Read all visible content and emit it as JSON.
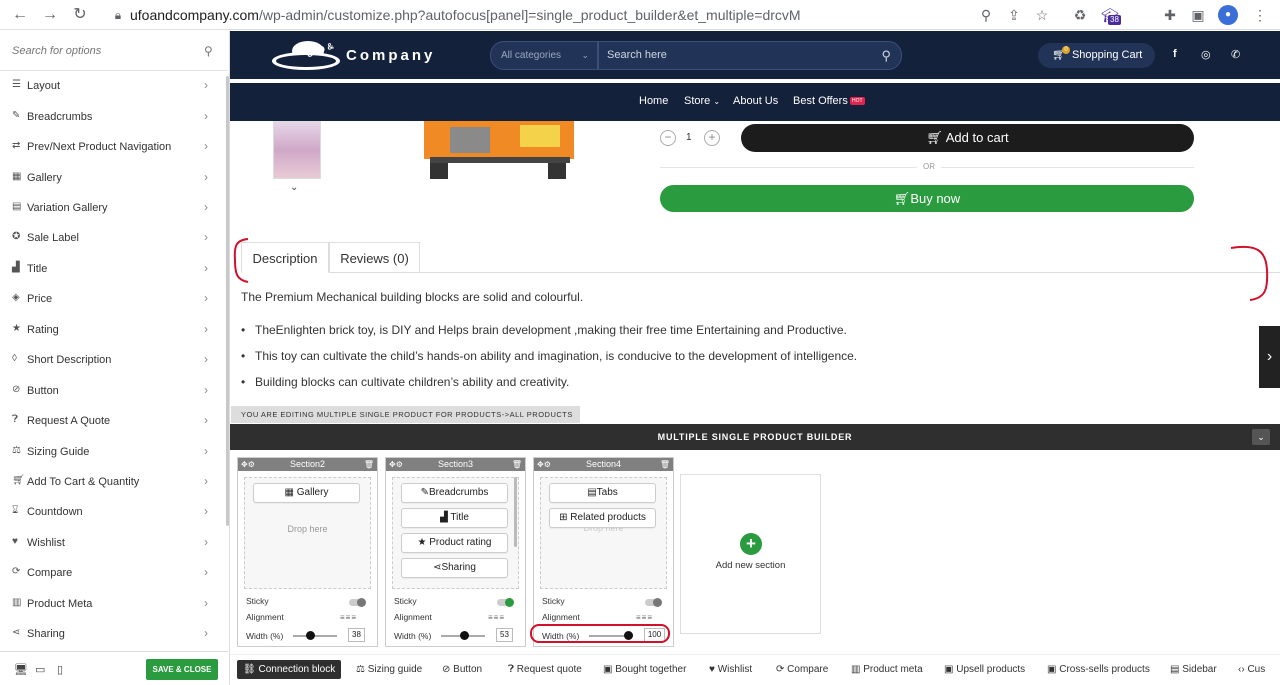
{
  "browser": {
    "url_host": "ufoandcompany.com",
    "url_path": "/wp-admin/customize.php?autofocus[panel]=single_product_builder&et_multiple=drcvM",
    "badge_count": "38"
  },
  "sidebar": {
    "search_placeholder": "Search for options",
    "items": [
      {
        "label": "Layout",
        "icon": "layout-icon"
      },
      {
        "label": "Breadcrumbs",
        "icon": "pen-icon"
      },
      {
        "label": "Prev/Next Product Navigation",
        "icon": "navigation-icon"
      },
      {
        "label": "Gallery",
        "icon": "gallery-icon"
      },
      {
        "label": "Variation Gallery",
        "icon": "variation-gallery-icon"
      },
      {
        "label": "Sale Label",
        "icon": "tag-icon"
      },
      {
        "label": "Title",
        "icon": "title-icon"
      },
      {
        "label": "Price",
        "icon": "price-tag-icon"
      },
      {
        "label": "Rating",
        "icon": "star-icon"
      },
      {
        "label": "Short Description",
        "icon": "description-icon"
      },
      {
        "label": "Button",
        "icon": "button-icon"
      },
      {
        "label": "Request A Quote",
        "icon": "question-icon"
      },
      {
        "label": "Sizing Guide",
        "icon": "ruler-icon"
      },
      {
        "label": "Add To Cart & Quantity",
        "icon": "cart-icon"
      },
      {
        "label": "Countdown",
        "icon": "hourglass-icon"
      },
      {
        "label": "Wishlist",
        "icon": "heart-icon"
      },
      {
        "label": "Compare",
        "icon": "compare-icon"
      },
      {
        "label": "Product Meta",
        "icon": "meta-icon"
      },
      {
        "label": "Sharing",
        "icon": "share-icon"
      }
    ],
    "save_label": "SAVE & CLOSE"
  },
  "site": {
    "logo_badge": "UFO &",
    "logo_text": "Company",
    "category_placeholder": "All categories",
    "search_placeholder": "Search here",
    "cart_label": "Shopping Cart",
    "cart_count": "0",
    "menu": [
      "Home",
      "Store",
      "About Us",
      "Best Offers"
    ],
    "hot_badge": "HOT"
  },
  "product": {
    "qty": "1",
    "add_to_cart": "Add to cart",
    "or": "OR",
    "buy_now": "Buy now",
    "tabs": [
      "Description",
      "Reviews (0)"
    ],
    "description_lead": "The Premium Mechanical building blocks are solid and colourful.",
    "bullets": [
      "TheEnlighten brick toy, is DIY and Helps brain development ,making their free time Entertaining and Productive.",
      "This toy can cultivate the child’s hands-on ability and imagination, is conducive to the development of intelligence.",
      "Building blocks can cultivate children’s ability and creativity."
    ]
  },
  "builder": {
    "editing_label": "YOU ARE EDITING MULTIPLE SINGLE PRODUCT FOR PRODUCTS->ALL PRODUCTS",
    "title": "MULTIPLE SINGLE PRODUCT BUILDER",
    "drop_here": "Drop here",
    "sticky_label": "Sticky",
    "alignment_label": "Alignment",
    "width_label": "Width (%)",
    "sections": [
      {
        "name": "Section2",
        "blocks": [
          "Gallery"
        ],
        "width": "38",
        "width_fraction": 0.38,
        "sticky": false
      },
      {
        "name": "Section3",
        "blocks": [
          "Breadcrumbs",
          "Title",
          "Product rating",
          "Sharing"
        ],
        "width": "53",
        "width_fraction": 0.53,
        "sticky": true
      },
      {
        "name": "Section4",
        "blocks": [
          "Tabs",
          "Related products"
        ],
        "width": "100",
        "width_fraction": 1.0,
        "sticky": false
      }
    ],
    "add_section": "Add new section",
    "bottom_blocks": [
      "Connection block",
      "Sizing guide",
      "Button",
      "Request quote",
      "Bought together",
      "Wishlist",
      "Compare",
      "Product meta",
      "Upsell products",
      "Cross-sells products",
      "Sidebar",
      "Cus"
    ]
  },
  "colors": {
    "header_navy": "#13213b",
    "green": "#2a9b3e",
    "annotation_red": "#d0112b"
  }
}
